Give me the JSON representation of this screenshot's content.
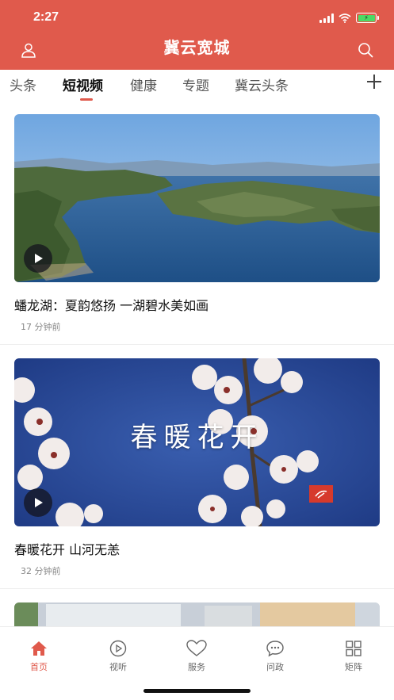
{
  "status": {
    "time": "2:27"
  },
  "header": {
    "title": "冀云宽城",
    "left_icon": "user-icon",
    "right_icon": "search-icon",
    "bg_color": "#e05a4c"
  },
  "tabs": [
    {
      "label": "头条",
      "active": false
    },
    {
      "label": "短视频",
      "active": true
    },
    {
      "label": "健康",
      "active": false
    },
    {
      "label": "专题",
      "active": false
    },
    {
      "label": "冀云头条",
      "active": false
    }
  ],
  "feed": [
    {
      "title": "蟠龙湖：夏韵悠扬 一湖碧水美如画",
      "time": "17 分钟前",
      "type": "video"
    },
    {
      "title": "春暖花开 山河无恙",
      "time": "32 分钟前",
      "type": "video",
      "overlay": "春暖花开"
    }
  ],
  "bottom_nav": [
    {
      "label": "首页",
      "icon": "home-icon",
      "active": true
    },
    {
      "label": "视听",
      "icon": "play-circle-icon",
      "active": false
    },
    {
      "label": "服务",
      "icon": "heart-icon",
      "active": false
    },
    {
      "label": "问政",
      "icon": "chat-bubble-icon",
      "active": false
    },
    {
      "label": "矩阵",
      "icon": "grid-icon",
      "active": false
    }
  ],
  "colors": {
    "accent": "#e05a4c",
    "inactive": "#666666"
  }
}
